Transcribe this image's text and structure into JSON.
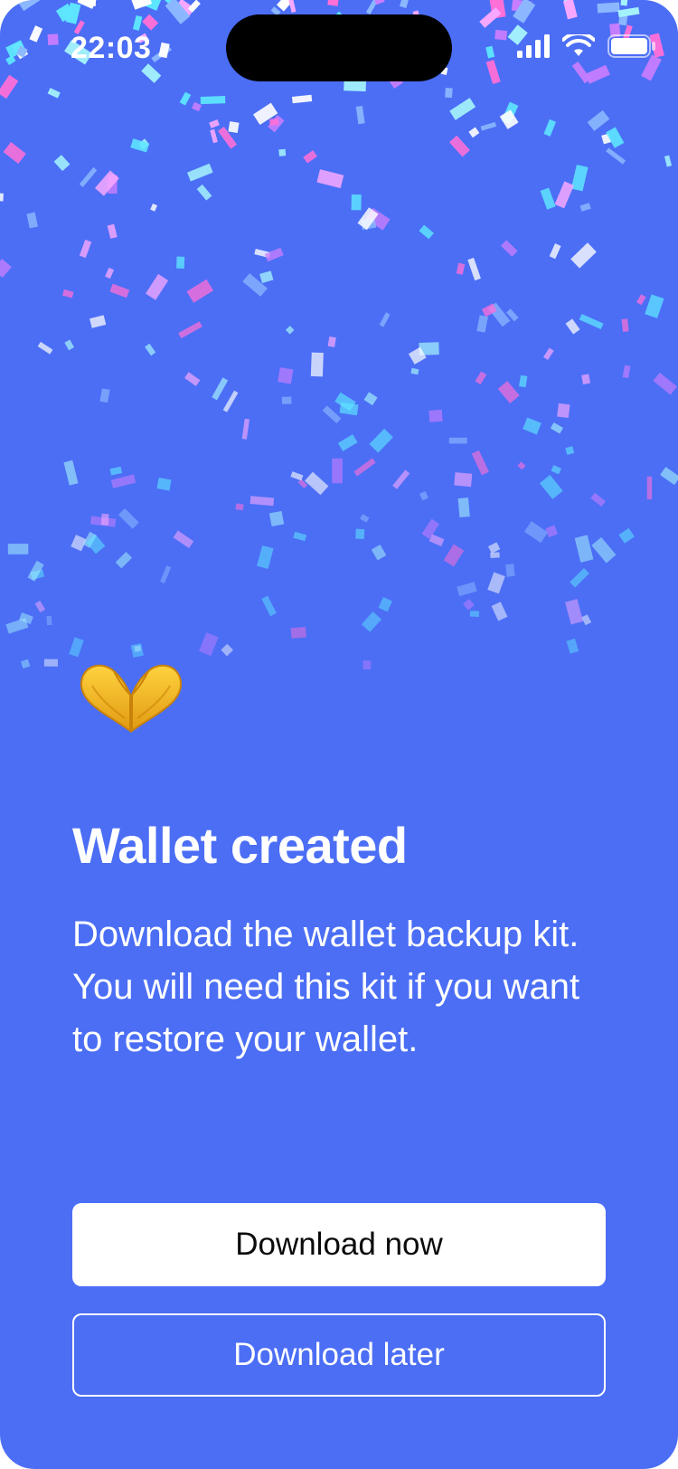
{
  "status_bar": {
    "time": "22:03",
    "icons": [
      "cellular-signal-icon",
      "wifi-icon",
      "battery-icon"
    ]
  },
  "colors": {
    "background": "#4b6ef5",
    "primary_button_bg": "#ffffff",
    "primary_button_text": "#0b0b0b",
    "text": "#ffffff",
    "confetti": [
      "#ffffff",
      "#ff6fd8",
      "#f9a8ff",
      "#c77dff",
      "#5ee6ff",
      "#a5f3fc",
      "#8bb8ff"
    ]
  },
  "hero": {
    "icon": "heart-hands-icon"
  },
  "main": {
    "title": "Wallet created",
    "description": "Download the wallet backup kit. You will need this kit if you want to restore your wallet."
  },
  "actions": {
    "primary_label": "Download now",
    "secondary_label": "Download later"
  }
}
